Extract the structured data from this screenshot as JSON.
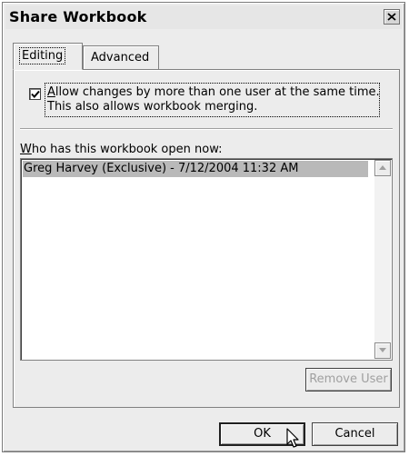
{
  "window": {
    "title": "Share Workbook"
  },
  "tabs": [
    {
      "label": "Editing",
      "active": true
    },
    {
      "label": "Advanced",
      "active": false
    }
  ],
  "editing": {
    "allow_changes": {
      "checked": true,
      "accel": "A",
      "line1_rest": "llow changes by more than one user at the same time.",
      "line2": "This also allows workbook merging."
    },
    "who_label": {
      "accel": "W",
      "rest": "ho has this workbook open now:"
    },
    "users": [
      "Greg Harvey (Exclusive) - 7/12/2004 11:32 AM"
    ],
    "remove_user_label": "Remove User"
  },
  "buttons": {
    "ok": "OK",
    "cancel": "Cancel"
  },
  "icons": {
    "close": "close-icon",
    "check": "checkmark-icon",
    "scroll_up": "arrow-up-icon",
    "scroll_down": "arrow-down-icon",
    "cursor": "mouse-pointer-icon"
  }
}
